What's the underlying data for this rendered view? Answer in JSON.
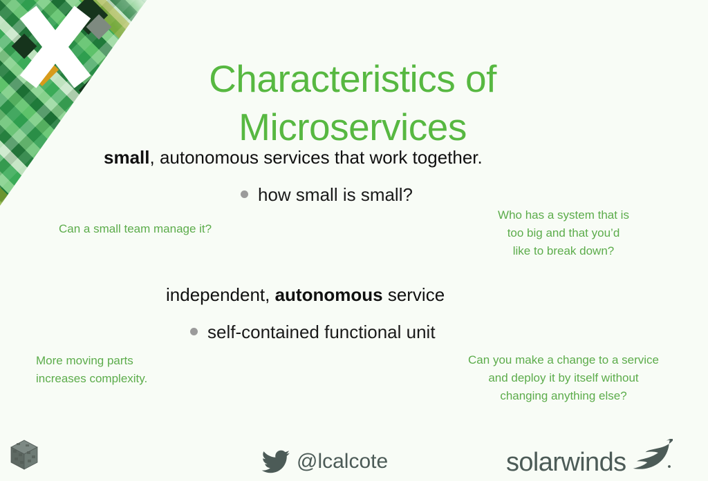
{
  "slide": {
    "title_line1": "Characteristics of",
    "title_line2": "Microservices",
    "title_color": "#57b841",
    "background_color": "#f8fcf6",
    "body_text_color": "#101010",
    "annotation_color": "#5cac4b",
    "footer_text_color": "#4c5b57",
    "bullet_color": "#9b9b9b"
  },
  "sections": [
    {
      "statement_bold": "small",
      "statement_rest": ", autonomous services that work together.",
      "sub_point": "how small is small?",
      "bullet_icon": "bullet-dot-icon"
    },
    {
      "statement_lead": "independent, ",
      "statement_bold": "autonomous",
      "statement_rest": " service",
      "sub_point": "self-contained functional unit",
      "bullet_icon": "bullet-dot-icon"
    }
  ],
  "annotations": {
    "team": {
      "lines": [
        "Can a small team manage it?"
      ]
    },
    "too_big": {
      "lines": [
        "Who has a system that is",
        "too big and that you’d",
        "like to break down?"
      ]
    },
    "moving_parts": {
      "lines": [
        "More moving parts",
        "increases complexity."
      ]
    },
    "deploy": {
      "lines": [
        "Can you make a change to a service",
        "and deploy it by itself without",
        "changing anything else?"
      ]
    }
  },
  "footer": {
    "twitter_handle": "@lcalcote",
    "twitter_icon": "twitter-bird-icon",
    "brand_name": "solarwinds",
    "brand_icon": "solarwinds-flame-icon",
    "corner_logo_icon": "cube-logo-icon"
  },
  "decoration": {
    "corner_graphic_icon": "plaid-triangle-graphic",
    "corner_letter": "X"
  }
}
